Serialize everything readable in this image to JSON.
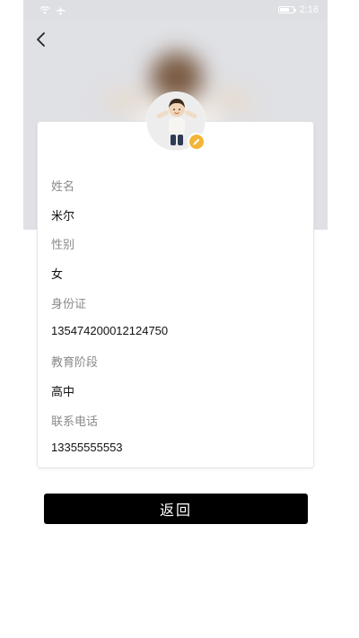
{
  "status_bar": {
    "time": "2:16",
    "icons": [
      "wifi-icon",
      "airplane-icon",
      "battery-icon"
    ]
  },
  "header": {
    "back_icon": "chevron-left-icon"
  },
  "profile": {
    "avatar_icon": "avatar",
    "edit_icon": "pencil-icon",
    "fields": [
      {
        "label": "姓名",
        "value": "米尔"
      },
      {
        "label": "性别",
        "value": "女"
      },
      {
        "label": "身份证",
        "value": "135474200012124750"
      },
      {
        "label": "教育阶段",
        "value": "高中"
      },
      {
        "label": "联系电话",
        "value": "13355555553"
      }
    ]
  },
  "actions": {
    "return_label": "返回"
  },
  "colors": {
    "status_bar_bg": "#dedfe3",
    "header_bg": "#e0e1e5",
    "button_bg": "#000000",
    "edit_badge": "#f3b437",
    "label_text": "#8a8a8a",
    "value_text": "#111111"
  }
}
